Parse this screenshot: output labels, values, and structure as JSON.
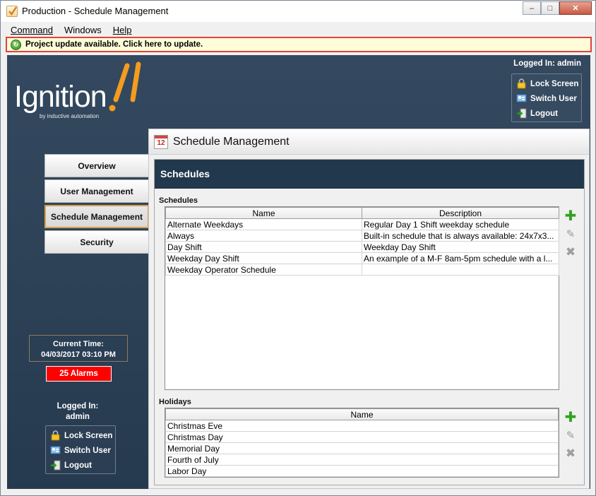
{
  "window": {
    "title": "Production - Schedule Management",
    "controls": {
      "minimize": "–",
      "maximize": "□",
      "close": "✕"
    }
  },
  "menu": {
    "items": [
      {
        "label": "Command"
      },
      {
        "label": "Windows"
      },
      {
        "label": "Help"
      }
    ]
  },
  "update_banner": {
    "text": "Project update available. Click here to update."
  },
  "brand": {
    "logo_text": "Ignition",
    "logo_sub": "by inductive automation",
    "accent": "#f39c1f"
  },
  "top_session": {
    "logged_in": "Logged In: admin",
    "actions": [
      "Lock Screen",
      "Switch User",
      "Logout"
    ]
  },
  "nav": {
    "items": [
      {
        "label": "Overview"
      },
      {
        "label": "User Management"
      },
      {
        "label": "Schedule Management"
      },
      {
        "label": "Security"
      }
    ],
    "active": "Schedule Management"
  },
  "status": {
    "time_label": "Current Time:",
    "time_value": "04/03/2017 03:10 PM",
    "alarms": "25 Alarms"
  },
  "left_session": {
    "logged_in_label": "Logged In:",
    "user": "admin",
    "actions": [
      "Lock Screen",
      "Switch User",
      "Logout"
    ]
  },
  "content": {
    "title": "Schedule Management",
    "calendar_day": "12",
    "panel_title": "Schedules",
    "schedules": {
      "label": "Schedules",
      "columns": [
        "Name",
        "Description"
      ],
      "rows": [
        [
          "Alternate Weekdays",
          "Regular Day 1 Shift weekday schedule"
        ],
        [
          "Always",
          "Built-in schedule that is always available: 24x7x3..."
        ],
        [
          "Day Shift",
          "Weekday Day Shift"
        ],
        [
          "Weekday Day Shift",
          "An example of a M-F 8am-5pm schedule with a l..."
        ],
        [
          "Weekday Operator Schedule",
          ""
        ]
      ]
    },
    "holidays": {
      "label": "Holidays",
      "columns": [
        "Name"
      ],
      "rows": [
        [
          "Christmas Eve"
        ],
        [
          "Christmas Day"
        ],
        [
          "Memorial Day"
        ],
        [
          "Fourth of July"
        ],
        [
          "Labor Day"
        ]
      ]
    },
    "tools": {
      "add": "add-icon",
      "edit": "edit-icon",
      "delete": "delete-icon"
    }
  },
  "colors": {
    "sidebar_bg": "#2e4359",
    "panel_header": "#21384d",
    "alarm_red": "#ff0000",
    "update_border": "#e0433b",
    "active_nav_border": "#d8a14a"
  }
}
